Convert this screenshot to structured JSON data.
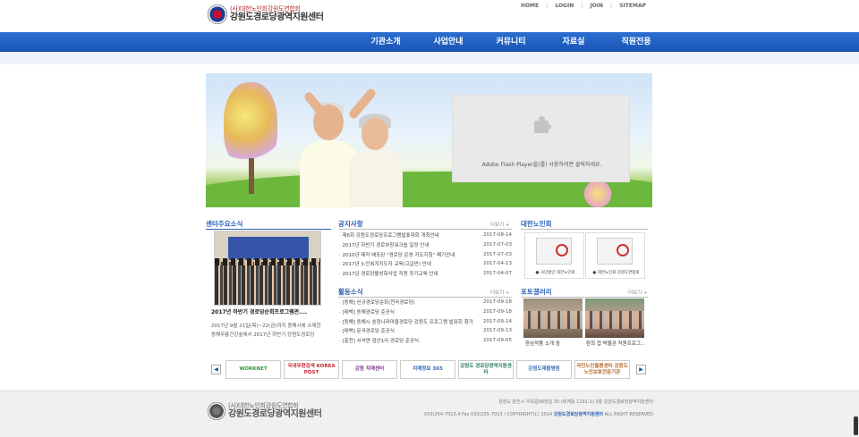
{
  "site": {
    "org_line": "(사)대한노인회강원도연합회",
    "name": "강원도경로당광역지원센터"
  },
  "topnav": [
    "HOME",
    "LOGIN",
    "JOIN",
    "SITEMAP"
  ],
  "gnb": [
    "기관소개",
    "사업안내",
    "커뮤니티",
    "자료실",
    "직원전용"
  ],
  "flash": {
    "message": "Adobe Flash Player을(를) 사용하려면 클릭하세요."
  },
  "center_news": {
    "title": "센터주요소식",
    "caption": "2017년 하반기 경로당순회프로그램관....",
    "desc": [
      "2017년 9월 21일(목)~22(금)까지 동해시에 소재한",
      "동해무릉건강숲에서 2017년 하반기 강원도경로당"
    ]
  },
  "notices": {
    "title": "공지사항",
    "more": "더보기 +",
    "items": [
      {
        "title": "· 제6회 강원도경로당프로그램발표대회 개최안내",
        "date": "2017-08-14"
      },
      {
        "title": "· 2017년 하반기 경로부장워크숍 일정 안내",
        "date": "2017-07-03"
      },
      {
        "title": "· 2010년 제작 배포된 \"경로당 운영 지도지침\" 폐기안내",
        "date": "2017-07-03"
      },
      {
        "title": "· 2017년 노인복지지도자 교육(고급반) 안내",
        "date": "2017-04-13"
      },
      {
        "title": "· 2017년 경로당활성화사업 직원 정기교육 안내",
        "date": "2017-04-07"
      }
    ]
  },
  "activities": {
    "title": "활동소식",
    "more": "더보기 +",
    "items": [
      {
        "title": "· [동해] 신규경로당순회(천곡경로당)",
        "date": "2017-09-18"
      },
      {
        "title": "· [태백] 동해경로당 준공식",
        "date": "2017-09-18"
      },
      {
        "title": "· [동해] 동해시 송정나라마을경로당 강원도 프로그램 발표회 참가",
        "date": "2017-09-14"
      },
      {
        "title": "· [태백] 문곡경로당 준공식",
        "date": "2017-09-13"
      },
      {
        "title": "· [홍천] 서석면 검산1리 경로당 준공식",
        "date": "2017-09-05"
      }
    ]
  },
  "assoc": {
    "title": "대한노인회",
    "boxes": [
      "● 사단법인 대한노인회",
      "● 대한노인회 강원도연합회"
    ]
  },
  "gallery": {
    "title": "포토갤러리",
    "more": "더보기 +",
    "items": [
      "환심작품 소개 중",
      "환희 컵 박물관 직원프로그..."
    ]
  },
  "partners": [
    "WORKNET",
    "국내우편검색 KOREA POST",
    "강원 치매센터",
    "치매정보 365",
    "강원도 경로당광역지원센터",
    "강원도재활병원",
    "국민노인돌봄센터 강원도노인보호전문기관"
  ],
  "footer": {
    "address": "강원도 춘천시 우묵길58번길 20 (퇴계동 1191-1) 3층 강원도경로당광역지원센터",
    "contact": "033)254-7013,4 Fax 033)255-7013 / COPYRIGHT(C) 2014",
    "copy_org": "강원도경로당광역지원센터",
    "rights": "ALL RIGHT RESERVED"
  },
  "colors": {
    "nav_blue": "#1a56b8",
    "title_blue": "#2a5fb5"
  }
}
